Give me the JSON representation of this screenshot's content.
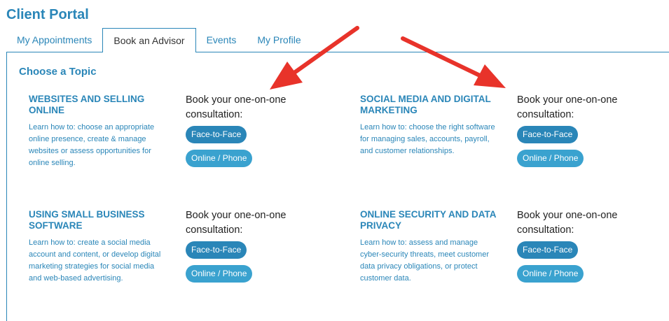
{
  "portal": {
    "title": "Client Portal"
  },
  "tabs": [
    {
      "label": "My Appointments"
    },
    {
      "label": "Book an Advisor",
      "active": true
    },
    {
      "label": "Events"
    },
    {
      "label": "My Profile"
    }
  ],
  "main": {
    "heading": "Choose a Topic",
    "booking_text": "Book your one-on-one consultation:",
    "face_to_face_label": "Face-to-Face",
    "online_phone_label": "Online / Phone",
    "topics": [
      {
        "title": "Websites and Selling Online",
        "description": "Learn how to: choose an appropriate online presence, create & manage websites or assess opportunities for online selling."
      },
      {
        "title": "Social Media and Digital Marketing",
        "description": "Learn how to: choose the right software for managing sales, accounts, payroll, and customer relationships."
      },
      {
        "title": "Using Small Business Software",
        "description": "Learn how to: create a social media account and content, or develop digital marketing strategies for social media and web-based advertising."
      },
      {
        "title": "Online Security and Data Privacy",
        "description": "Learn how to: assess and manage cyber-security threats, meet customer data privacy obligations, or protect customer data."
      }
    ]
  },
  "annotations": {
    "arrow_color": "#e8332a"
  },
  "colors": {
    "accent": "#2a86b8",
    "button_light": "#3aa2cf"
  }
}
